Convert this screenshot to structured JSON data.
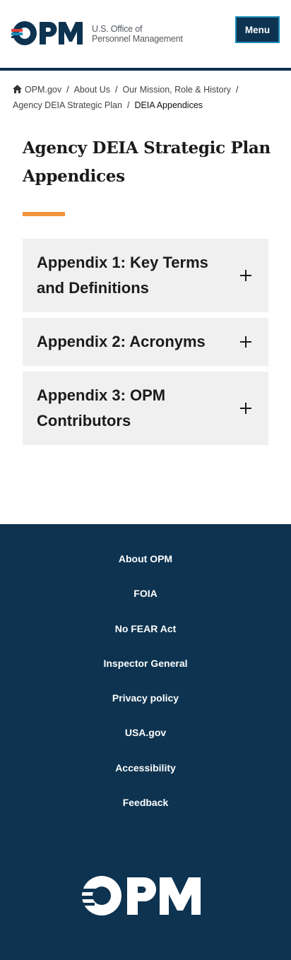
{
  "header": {
    "logo_text": "OPM",
    "agency_line1": "U.S. Office of",
    "agency_line2": "Personnel Management",
    "menu_label": "Menu"
  },
  "breadcrumb": {
    "items": [
      {
        "label": "OPM.gov"
      },
      {
        "label": "About Us"
      },
      {
        "label": "Our Mission, Role & History"
      },
      {
        "label": "Agency DEIA Strategic Plan"
      }
    ],
    "current": "DEIA Appendices"
  },
  "page": {
    "title": "Agency DEIA Strategic Plan Appendices"
  },
  "accordion": {
    "items": [
      {
        "label": "Appendix 1: Key Terms and Definitions"
      },
      {
        "label": "Appendix 2: Acronyms"
      },
      {
        "label": "Appendix 3: OPM Contributors"
      }
    ]
  },
  "footer": {
    "links": [
      {
        "label": "About OPM"
      },
      {
        "label": "FOIA"
      },
      {
        "label": "No FEAR Act"
      },
      {
        "label": "Inspector General"
      },
      {
        "label": "Privacy policy"
      },
      {
        "label": "USA.gov"
      },
      {
        "label": "Accessibility"
      },
      {
        "label": "Feedback"
      }
    ],
    "logo_text": "OPM"
  },
  "colors": {
    "navy": "#0d3350",
    "accent_orange": "#f2933a",
    "accordion_bg": "#f0f0f0",
    "logo_red": "#e0413b",
    "logo_blue": "#1a8ab8"
  }
}
